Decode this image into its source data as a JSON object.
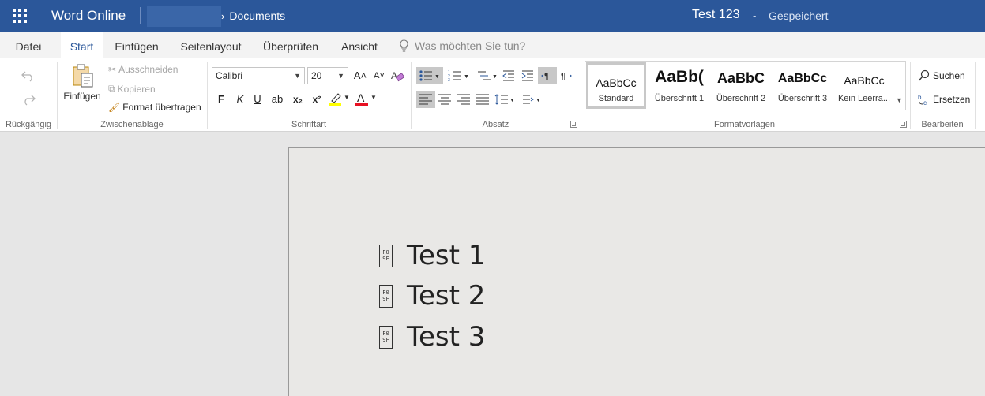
{
  "titlebar": {
    "app_name": "Word Online",
    "breadcrumb": "Documents",
    "doc_title": "Test 123",
    "separator": "-",
    "save_status": "Gespeichert"
  },
  "tabs": [
    "Datei",
    "Start",
    "Einfügen",
    "Seitenlayout",
    "Überprüfen",
    "Ansicht"
  ],
  "active_tab": "Start",
  "tell_me_placeholder": "Was möchten Sie tun?",
  "ribbon": {
    "undo_group": {
      "label": "Rückgängig"
    },
    "clipboard": {
      "label": "Zwischenablage",
      "paste": "Einfügen",
      "cut": "Ausschneiden",
      "copy": "Kopieren",
      "format_painter": "Format übertragen"
    },
    "font": {
      "label": "Schriftart",
      "font_name": "Calibri",
      "font_size": "20",
      "bold": "F",
      "italic": "K",
      "underline": "U",
      "strike": "ab",
      "subscript": "x₂",
      "superscript": "x²",
      "font_color": "A"
    },
    "paragraph": {
      "label": "Absatz"
    },
    "styles": {
      "label": "Formatvorlagen",
      "items": [
        {
          "preview": "AaBbCc",
          "name": "Standard"
        },
        {
          "preview": "AaBb(",
          "name": "Überschrift 1"
        },
        {
          "preview": "AaBbC",
          "name": "Überschrift 2"
        },
        {
          "preview": "AaBbCc",
          "name": "Überschrift 3"
        },
        {
          "preview": "AaBbCc",
          "name": "Kein Leerra..."
        }
      ]
    },
    "editing": {
      "label": "Bearbeiten",
      "find": "Suchen",
      "replace": "Ersetzen"
    }
  },
  "document": {
    "missing_glyph": "F0 9F",
    "lines": [
      "Test 1",
      "Test 2",
      "Test 3"
    ]
  },
  "colors": {
    "brand": "#2b579a",
    "highlight": "#ffff00",
    "font_color_bar": "#e81123"
  }
}
